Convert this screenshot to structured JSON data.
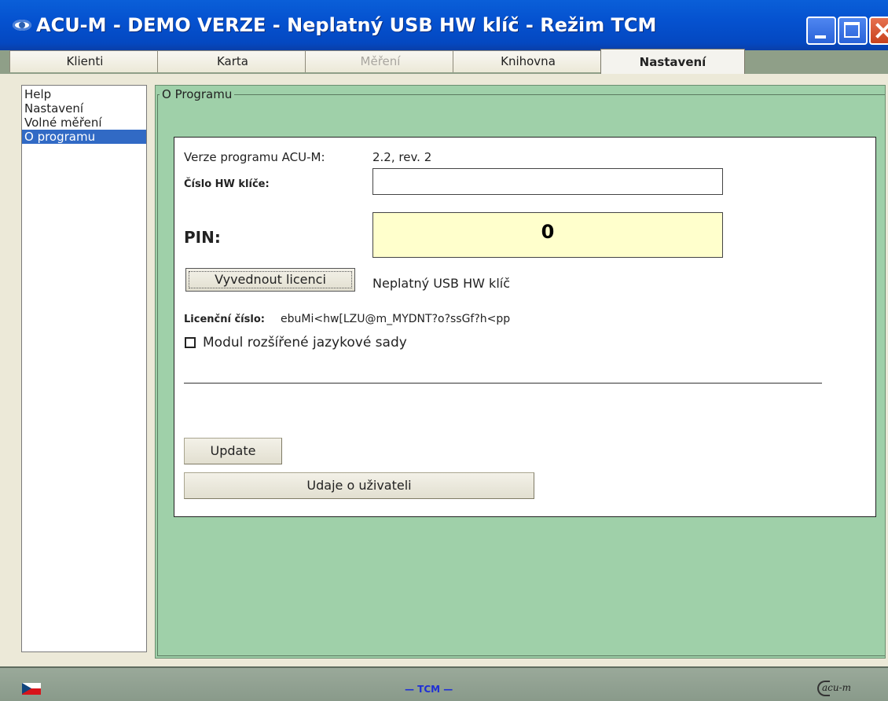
{
  "window": {
    "title": "ACU-M - DEMO VERZE - Neplatný USB HW klíč - Režim TCM"
  },
  "tabs": [
    {
      "label": "Klienti",
      "state": "normal"
    },
    {
      "label": "Karta",
      "state": "normal"
    },
    {
      "label": "Měření",
      "state": "disabled"
    },
    {
      "label": "Knihovna",
      "state": "normal"
    },
    {
      "label": "Nastavení",
      "state": "active"
    }
  ],
  "sidebar": {
    "items": [
      {
        "label": "Help"
      },
      {
        "label": "Nastavení"
      },
      {
        "label": "Volné měření"
      },
      {
        "label": "O programu",
        "selected": true
      }
    ]
  },
  "about": {
    "group_title": "O Programu",
    "version_label": "Verze programu ACU-M:",
    "version_value": "2.2, rev. 2",
    "hw_key_label": "Číslo HW klíče:",
    "hw_key_value": "",
    "pin_label": "PIN:",
    "pin_value": "0",
    "license_button": "Vyvednout licenci",
    "license_status": "Neplatný USB HW klíč",
    "license_number_label": "Licenční číslo:",
    "license_number_value": "ebuMi<hw[LZU@m_MYDNT?o?ssGf?h<pp",
    "module_checkbox_label": "Modul rozšířené jazykové sady",
    "module_checked": false,
    "update_button": "Update",
    "user_info_button": "Udaje o uživateli"
  },
  "statusbar": {
    "mode": "— TCM —",
    "logo_text": "acu-m"
  }
}
